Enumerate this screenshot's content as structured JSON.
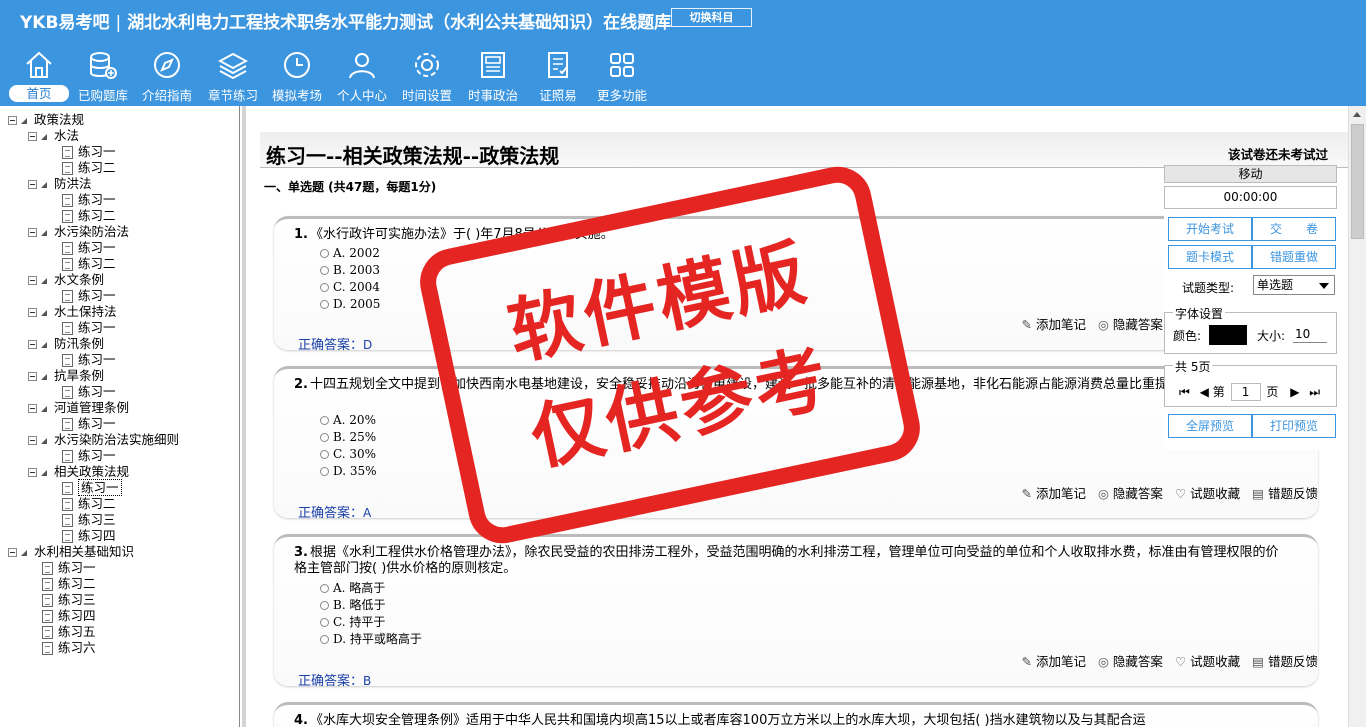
{
  "header": {
    "brand": "YKB易考吧",
    "title": "湖北水利电力工程技术职务水平能力测试（水利公共基础知识）在线题库",
    "switch_label": "切换科目"
  },
  "toolbar": [
    {
      "label": "首页",
      "icon": "home-icon"
    },
    {
      "label": "已购题库",
      "icon": "database-add-icon"
    },
    {
      "label": "介绍指南",
      "icon": "compass-icon"
    },
    {
      "label": "章节练习",
      "icon": "layers-icon"
    },
    {
      "label": "模拟考场",
      "icon": "clock-icon"
    },
    {
      "label": "个人中心",
      "icon": "user-icon"
    },
    {
      "label": "时间设置",
      "icon": "gear-icon"
    },
    {
      "label": "时事政治",
      "icon": "newspaper-icon"
    },
    {
      "label": "证照易",
      "icon": "checklist-icon"
    },
    {
      "label": "更多功能",
      "icon": "grid-icon"
    }
  ],
  "tree": [
    {
      "label": "政策法规",
      "level": 0,
      "kind": "folder"
    },
    {
      "label": "水法",
      "level": 1,
      "kind": "folder"
    },
    {
      "label": "练习一",
      "level": 2,
      "kind": "doc"
    },
    {
      "label": "练习二",
      "level": 2,
      "kind": "doc"
    },
    {
      "label": "防洪法",
      "level": 1,
      "kind": "folder"
    },
    {
      "label": "练习一",
      "level": 2,
      "kind": "doc"
    },
    {
      "label": "练习二",
      "level": 2,
      "kind": "doc"
    },
    {
      "label": "水污染防治法",
      "level": 1,
      "kind": "folder"
    },
    {
      "label": "练习一",
      "level": 2,
      "kind": "doc"
    },
    {
      "label": "练习二",
      "level": 2,
      "kind": "doc"
    },
    {
      "label": "水文条例",
      "level": 1,
      "kind": "folder"
    },
    {
      "label": "练习一",
      "level": 2,
      "kind": "doc"
    },
    {
      "label": "水土保持法",
      "level": 1,
      "kind": "folder"
    },
    {
      "label": "练习一",
      "level": 2,
      "kind": "doc"
    },
    {
      "label": "防汛条例",
      "level": 1,
      "kind": "folder"
    },
    {
      "label": "练习一",
      "level": 2,
      "kind": "doc"
    },
    {
      "label": "抗旱条例",
      "level": 1,
      "kind": "folder"
    },
    {
      "label": "练习一",
      "level": 2,
      "kind": "doc"
    },
    {
      "label": "河道管理条例",
      "level": 1,
      "kind": "folder"
    },
    {
      "label": "练习一",
      "level": 2,
      "kind": "doc"
    },
    {
      "label": "水污染防治法实施细则",
      "level": 1,
      "kind": "folder"
    },
    {
      "label": "练习一",
      "level": 2,
      "kind": "doc"
    },
    {
      "label": "相关政策法规",
      "level": 1,
      "kind": "folder"
    },
    {
      "label": "练习一",
      "level": 2,
      "kind": "doc",
      "selected": true
    },
    {
      "label": "练习二",
      "level": 2,
      "kind": "doc"
    },
    {
      "label": "练习三",
      "level": 2,
      "kind": "doc"
    },
    {
      "label": "练习四",
      "level": 2,
      "kind": "doc"
    },
    {
      "label": "水利相关基础知识",
      "level": 0,
      "kind": "folder"
    },
    {
      "label": "练习一",
      "level": 1,
      "kind": "doc"
    },
    {
      "label": "练习二",
      "level": 1,
      "kind": "doc"
    },
    {
      "label": "练习三",
      "level": 1,
      "kind": "doc"
    },
    {
      "label": "练习四",
      "level": 1,
      "kind": "doc"
    },
    {
      "label": "练习五",
      "level": 1,
      "kind": "doc"
    },
    {
      "label": "练习六",
      "level": 1,
      "kind": "doc"
    }
  ],
  "main": {
    "paper_title": "练习一--相关政策法规--政策法规",
    "exam_status": "该试卷还未考试过",
    "section_title": "一、单选题 (共47题，每题1分)"
  },
  "questions": [
    {
      "num": "1.",
      "text": "《水行政许可实施办法》于( )年7月8号公布并实施。",
      "options": [
        "A. 2002",
        "B. 2003",
        "C. 2004",
        "D. 2005"
      ],
      "answer_label": "正确答案：",
      "answer": "D"
    },
    {
      "num": "2.",
      "text": "十四五规划全文中提到，加快西南水电基地建设，安全稳妥推动沿海核电建设，建设一批多能互补的清洁能源基地，非化石能源占能源消费总量比重提高到( )左右。",
      "options": [
        "A. 20%",
        "B. 25%",
        "C. 30%",
        "D. 35%"
      ],
      "answer_label": "正确答案：",
      "answer": "A"
    },
    {
      "num": "3.",
      "text": "根据《水利工程供水价格管理办法》，除农民受益的农田排涝工程外，受益范围明确的水利排涝工程，管理单位可向受益的单位和个人收取排水费，标准由有管理权限的价格主管部门按( )供水价格的原则核定。",
      "options": [
        "A. 略高于",
        "B. 略低于",
        "C. 持平于",
        "D. 持平或略高于"
      ],
      "answer_label": "正确答案：",
      "answer": "B"
    },
    {
      "num": "4.",
      "text": "《水库大坝安全管理条例》适用于中华人民共和国境内坝高15以上或者库容100万立方米以上的水库大坝，大坝包括( )挡水建筑物以及与其配合运",
      "options": [],
      "answer_label": "",
      "answer": ""
    }
  ],
  "actions": {
    "note": "添加笔记",
    "hide": "隐藏答案",
    "fav": "试题收藏",
    "report": "错题反馈"
  },
  "side": {
    "move": "移动",
    "timer": "00:00:00",
    "start": "开始考试",
    "submit": "交　　卷",
    "card_mode": "题卡模式",
    "redo": "错题重做",
    "type_label": "试题类型:",
    "type_value": "单选题",
    "font_legend": "字体设置",
    "color_label": "颜色:",
    "size_label": "大小:",
    "size_value": "10",
    "color_value": "#000000",
    "pages_legend": "共 5页",
    "page_prefix": "第",
    "page_value": "1",
    "page_suffix": "页",
    "fullscreen": "全屏预览",
    "print": "打印预览"
  },
  "watermark": {
    "line1": "软件模版",
    "line2": "仅供参考"
  },
  "colors": {
    "header": "#3c95df",
    "accent": "#3c95df",
    "answer": "#1a3fa8",
    "stamp": "#e52521"
  }
}
